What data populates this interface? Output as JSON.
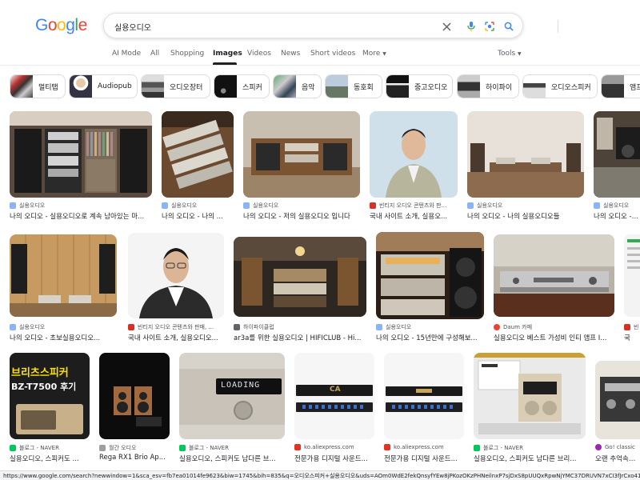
{
  "header": {
    "logo": [
      "G",
      "o",
      "o",
      "g",
      "l",
      "e"
    ],
    "logo_colors": [
      "#4285f4",
      "#ea4335",
      "#fbbc05",
      "#4285f4",
      "#34a853",
      "#ea4335"
    ],
    "search_value": "실용오디오"
  },
  "tabs": [
    "AI Mode",
    "All",
    "Shopping",
    "Images",
    "Videos",
    "News",
    "Short videos",
    "More"
  ],
  "active_tab": "Images",
  "tools_label": "Tools",
  "chips": [
    "멀티탭",
    "Audiopub",
    "오디오장터",
    "스피커",
    "음악",
    "동호회",
    "중고오디오",
    "하이파이",
    "오디오스피커",
    "앰프"
  ],
  "results": [
    {
      "source": "실용오디오",
      "title": "나의 오디오 - 실용오디오로 계속 남아있는 마..."
    },
    {
      "source": "실용오디오",
      "title": "나의 오디오 - 나의 ..."
    },
    {
      "source": "실용오디오",
      "title": "나의 오디오 - 저의 실용오디오 입니다"
    },
    {
      "source": "빈티지 오디오 콘텐츠와 판...",
      "title": "국내 사이트 소개, 실용오..."
    },
    {
      "source": "실용오디오",
      "title": "나의 오디오 - 나의 실용오디오들"
    },
    {
      "source": "실용오디오",
      "title": "나의 오디오 - 나"
    },
    {
      "source": "실용오디오",
      "title": "나의 오디오 - 초보실용오디오..."
    },
    {
      "source": "빈티지 오디오 콘텐츠와 판매, ...",
      "title": "국내 사이트 소개, 실용오디오..."
    },
    {
      "source": "하이파이클럽",
      "title": "ar3a를 위한 실용오디오 | HIFICLUB - Hi..."
    },
    {
      "source": "실용오디오",
      "title": "나의 오디오 - 15년만에 구성해보..."
    },
    {
      "source": "Daum 카페",
      "title": "실용오디오 베스트 가성비 인티 앰프 I..."
    },
    {
      "source": "빈",
      "title": "국"
    },
    {
      "source": "블로그 - NAVER",
      "title": "실용오디오, 스피커도 ..."
    },
    {
      "source": "월간 오디오",
      "title": "Rega RX1 Brio Ap..."
    },
    {
      "source": "블로그 - NAVER",
      "title": "실용오디오, 스피커도 남다른 브..."
    },
    {
      "source": "ko.aliexpress.com",
      "title": "전문가용 디지털 사운드..."
    },
    {
      "source": "ko.aliexpress.com",
      "title": "전문가용 디지털 사운드..."
    },
    {
      "source": "블로그 - NAVER",
      "title": "실용오디오, 스피커도 남다른 브리..."
    },
    {
      "source": "Go! classic",
      "title": "오랜 추억속의 ..."
    }
  ],
  "thumb_texts": {
    "speaker_text_1": "브리츠스피커",
    "speaker_text_2": "BZ-T7500 후기",
    "display_text": "LOADING",
    "brand_text": "CA"
  },
  "status_url": "https://www.google.com/search?newwindow=1&sca_esv=fb7ea01014fe9623&biw=1745&bih=835&q=오디오스피커+실용오디오&uds=AOm0WdE2fekQnsyfYEw8jPKozOKzPHNeilnxP7sjDxS8pUUQxRpwNjYMC37DRUVN7xCI3fJrCxo41e_NnWvjCYG0xQSGpM7rRw80S"
}
